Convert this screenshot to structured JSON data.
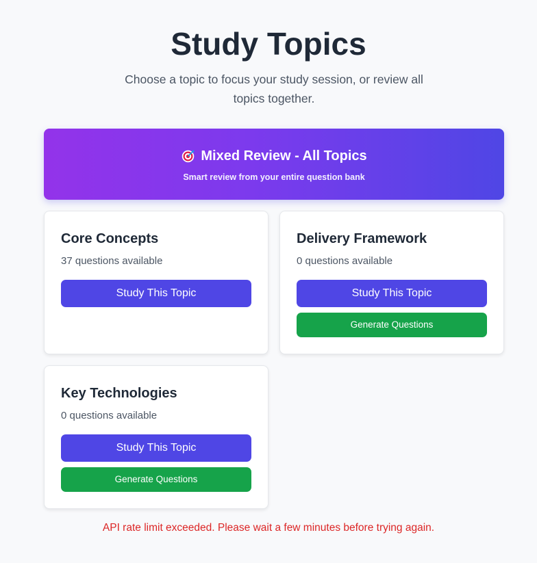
{
  "header": {
    "title": "Study Topics",
    "subtitle": "Choose a topic to focus your study session, or review all topics together."
  },
  "mixed_review": {
    "icon": "target-icon",
    "title": "Mixed Review - All Topics",
    "subtitle": "Smart review from your entire question bank"
  },
  "topics": [
    {
      "name": "Core Concepts",
      "count_text": "37 questions available",
      "study_label": "Study This Topic"
    },
    {
      "name": "Delivery Framework",
      "count_text": "0 questions available",
      "study_label": "Study This Topic",
      "generate_label": "Generate Questions"
    },
    {
      "name": "Key Technologies",
      "count_text": "0 questions available",
      "study_label": "Study This Topic",
      "generate_label": "Generate Questions"
    }
  ],
  "error": {
    "message": "API rate limit exceeded. Please wait a few minutes before trying again."
  },
  "colors": {
    "background": "#f8f9fb",
    "primary_button": "#4f46e5",
    "generate_button": "#16a34a",
    "error_text": "#dc2626",
    "gradient_start": "#9333ea",
    "gradient_end": "#4f46e5"
  }
}
